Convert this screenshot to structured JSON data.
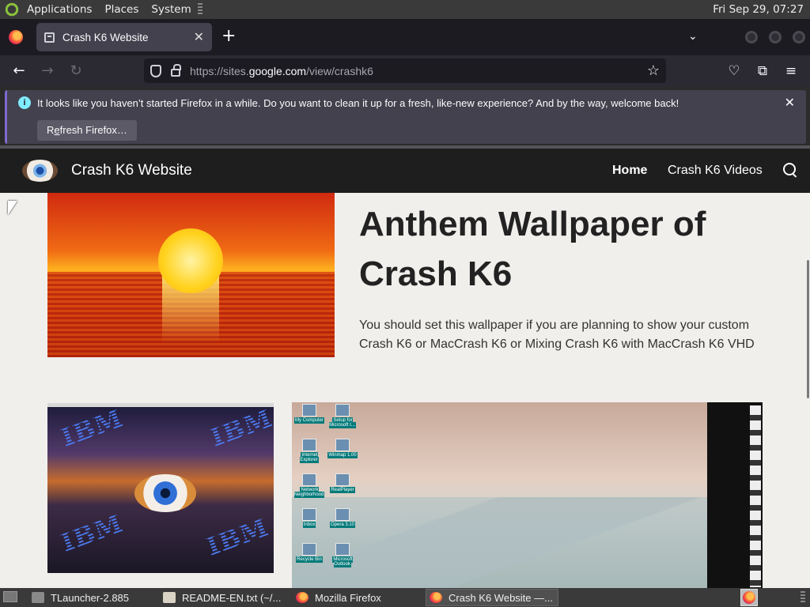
{
  "panel": {
    "menus": [
      "Applications",
      "Places",
      "System"
    ],
    "clock": "Fri Sep 29, 07:27"
  },
  "browser": {
    "tab_title": "Crash K6 Website",
    "url_prefix": "https://sites.",
    "url_host": "google.com",
    "url_path": "/view/crashk6",
    "notification": {
      "message": "It looks like you haven’t started Firefox in a while. Do you want to clean it up for a fresh, like-new experience? And by the way, welcome back!",
      "button_first": "R",
      "button_u": "e",
      "button_rest": "fresh Firefox…"
    }
  },
  "site": {
    "title": "Crash K6 Website",
    "nav": [
      "Home",
      "Crash K6 Videos"
    ],
    "heading": "Anthem Wallpaper of Crash K6",
    "description": "You should set this wallpaper if you are planning to show your custom Crash K6 or MacCrash K6 or Mixing Crash K6 with MacCrash K6 VHD",
    "wallpaper_text": "IBM",
    "desktop_icons": [
      "My Computer",
      "Setup for Microsoft I...",
      "Internet Explorer",
      "Winmap 1.00",
      "Network Neighborhood",
      "RealPlayer",
      "Inbox",
      "Opera 3.10",
      "Recycle Bin",
      "Microsoft Outlook"
    ]
  },
  "taskbar": {
    "tasks": [
      "TLauncher-2.885",
      "README-EN.txt (~/...",
      "Mozilla Firefox",
      "Crash K6 Website —..."
    ]
  },
  "colors": {
    "accent": "#7f6ad0",
    "site_header": "#1e1e1e",
    "page_bg": "#f1efec"
  }
}
